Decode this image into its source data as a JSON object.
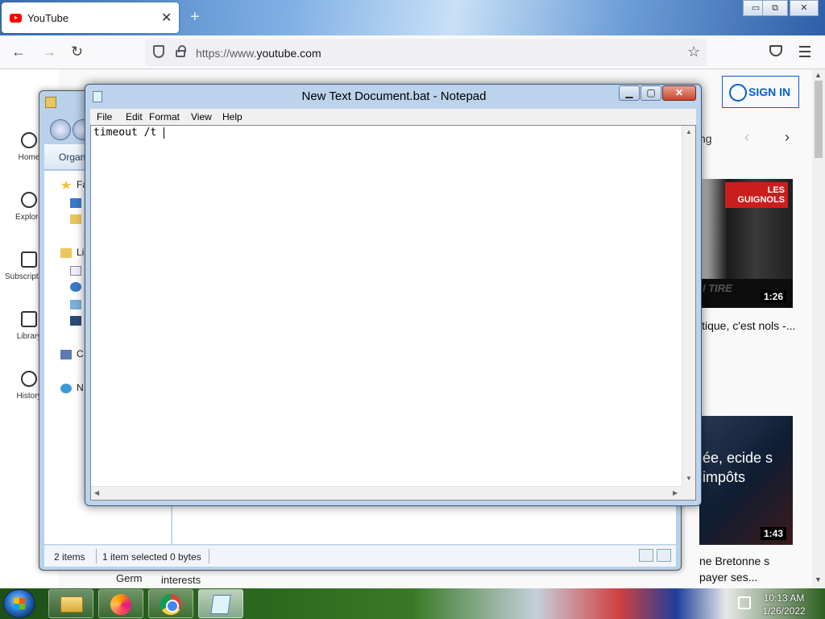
{
  "firefox": {
    "tab_title": "YouTube",
    "tab_close": "✕",
    "new_tab": "+",
    "url_prefix": "https://www.",
    "url_domain": "youtube.com",
    "window_controls": [
      "▭",
      "⧉",
      "✕"
    ]
  },
  "youtube": {
    "sidebar": [
      {
        "label": "Home"
      },
      {
        "label": "Explore"
      },
      {
        "label": "Subscriptions"
      },
      {
        "label": "Library"
      },
      {
        "label": "History"
      }
    ],
    "sign_in": "SIGN IN",
    "chip_partial": "ng",
    "video1": {
      "tag": "LES GUIGNOLS",
      "subtitle": "I TIRE",
      "duration": "1:26",
      "title": "itique, c'est nols -..."
    },
    "video2": {
      "overlay": "ée, ecide s impôts",
      "duration": "1:43",
      "title": "ne Bretonne s payer ses..."
    },
    "bottom_left": "Germ",
    "bottom_mid": "interests"
  },
  "explorer": {
    "organize": "Organ",
    "tree": [
      "Fa",
      "Li",
      "C",
      "N"
    ],
    "status_items": "2 items",
    "status_selected": "1 item selected",
    "status_size": "0 bytes"
  },
  "notepad": {
    "title": "New Text Document.bat - Notepad",
    "menu": [
      "File",
      "Edit",
      "Format",
      "View",
      "Help"
    ],
    "content": "timeout /t ",
    "controls": {
      "minimize": "▁",
      "maximize": "▢",
      "close": "✕"
    }
  },
  "taskbar": {
    "time": "10:13 AM",
    "date": "1/26/2022"
  }
}
